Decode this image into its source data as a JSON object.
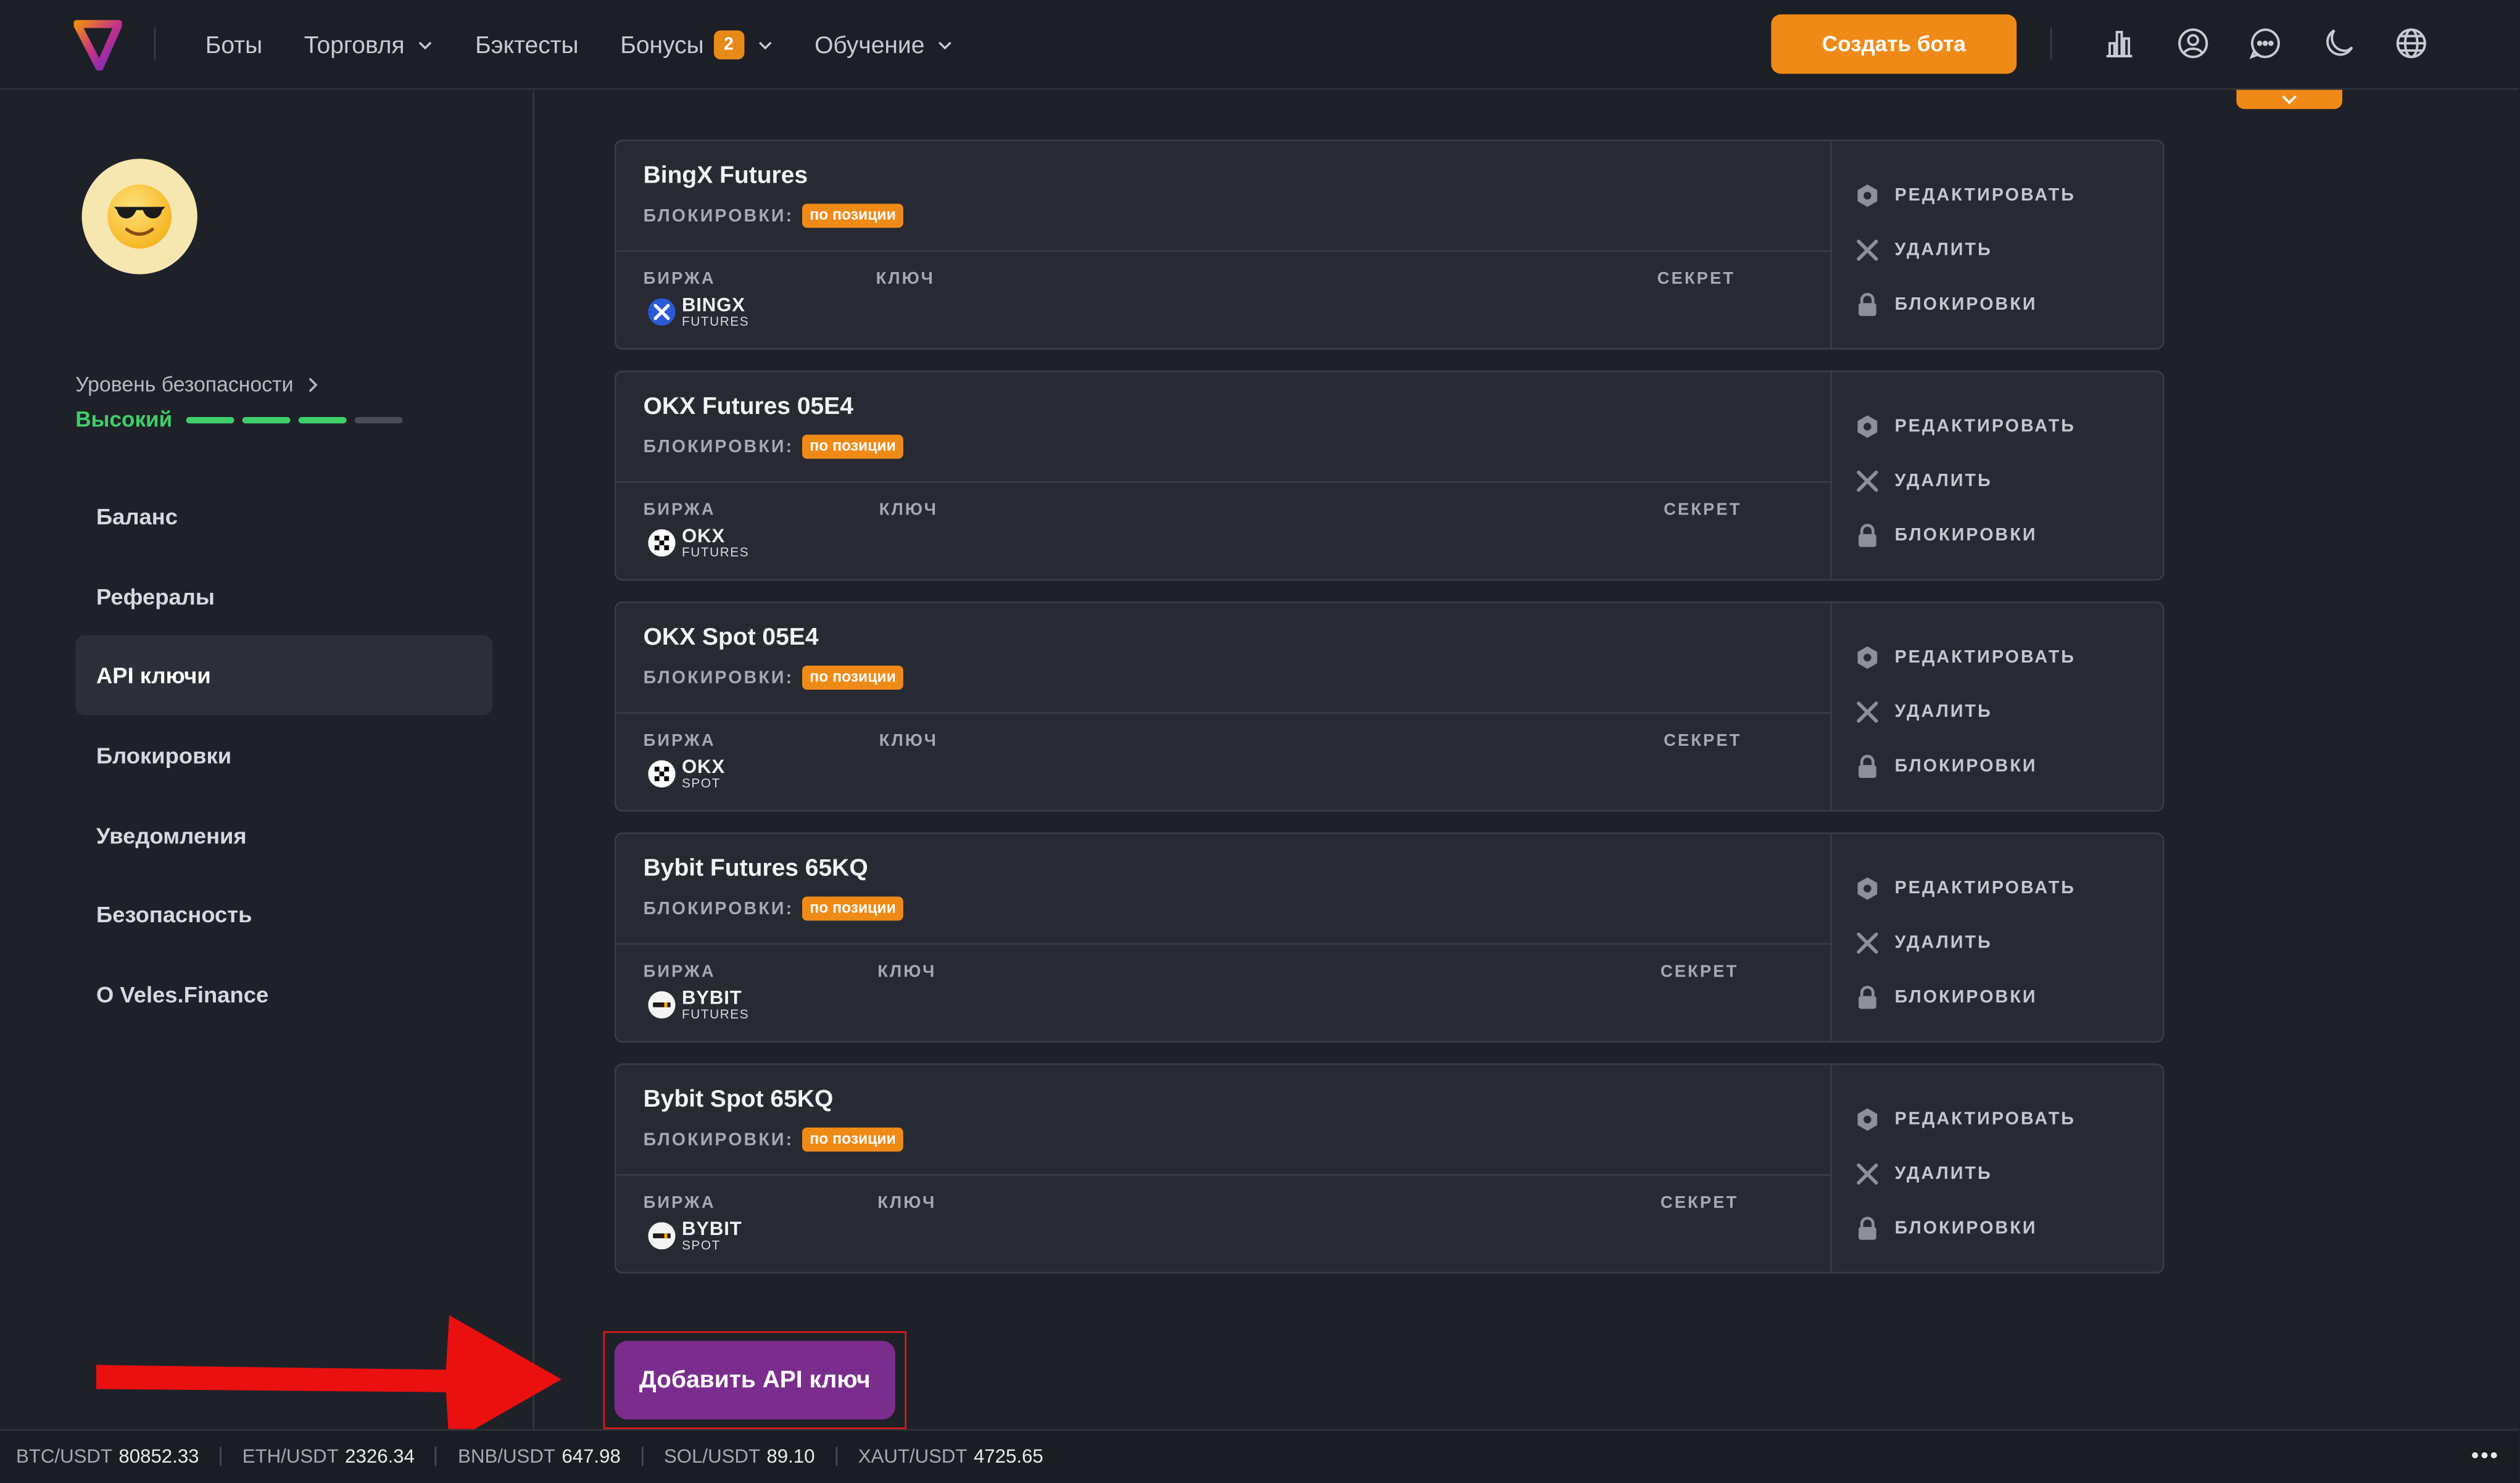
{
  "header": {
    "nav": [
      {
        "label": "Боты",
        "has_chevron": false
      },
      {
        "label": "Торговля",
        "has_chevron": true
      },
      {
        "label": "Бэктесты",
        "has_chevron": false
      },
      {
        "label": "Бонусы",
        "has_chevron": true,
        "badge": "2"
      },
      {
        "label": "Обучение",
        "has_chevron": true
      }
    ],
    "create_label": "Создать бота",
    "icons": [
      "chart-icon",
      "user-icon",
      "chat-icon",
      "moon-icon",
      "globe-icon"
    ],
    "accent": "#f08a17"
  },
  "sidebar": {
    "security_label": "Уровень безопасности",
    "security_level": "Высокий",
    "security_bars": {
      "filled": 3,
      "total": 4
    },
    "menu": [
      {
        "label": "Баланс",
        "active": false
      },
      {
        "label": "Рефералы",
        "active": false
      },
      {
        "label": "API ключи",
        "active": true
      },
      {
        "label": "Блокировки",
        "active": false
      },
      {
        "label": "Уведомления",
        "active": false
      },
      {
        "label": "Безопасность",
        "active": false
      },
      {
        "label": "О Veles.Finance",
        "active": false
      }
    ]
  },
  "labels": {
    "locks": "БЛОКИРОВКИ:",
    "exchange": "БИРЖА",
    "key": "КЛЮЧ",
    "secret": "СЕКРЕТ",
    "edit": "РЕДАКТИРОВАТЬ",
    "delete": "УДАЛИТЬ",
    "blocks": "БЛОКИРОВКИ"
  },
  "keys": [
    {
      "title": "BingX Futures",
      "tag": "по позиции",
      "exchange_name": "BINGX",
      "exchange_type": "FUTURES",
      "icon": "bingx-icon"
    },
    {
      "title": "OKX Futures 05E4",
      "tag": "по позиции",
      "exchange_name": "OKX",
      "exchange_type": "FUTURES",
      "icon": "okx-icon"
    },
    {
      "title": "OKX Spot 05E4",
      "tag": "по позиции",
      "exchange_name": "OKX",
      "exchange_type": "SPOT",
      "icon": "okx-icon"
    },
    {
      "title": "Bybit Futures 65KQ",
      "tag": "по позиции",
      "exchange_name": "BYBIT",
      "exchange_type": "FUTURES",
      "icon": "bybit-icon"
    },
    {
      "title": "Bybit Spot 65KQ",
      "tag": "по позиции",
      "exchange_name": "BYBIT",
      "exchange_type": "SPOT",
      "icon": "bybit-icon"
    }
  ],
  "add_button_label": "Добавить API ключ",
  "ticker": [
    {
      "pair": "BTC/USDT",
      "price": "80852.33"
    },
    {
      "pair": "ETH/USDT",
      "price": "2326.34"
    },
    {
      "pair": "BNB/USDT",
      "price": "647.98"
    },
    {
      "pair": "SOL/USDT",
      "price": "89.10"
    },
    {
      "pair": "XAUT/USDT",
      "price": "4725.65"
    }
  ],
  "ticker_more": "•••"
}
